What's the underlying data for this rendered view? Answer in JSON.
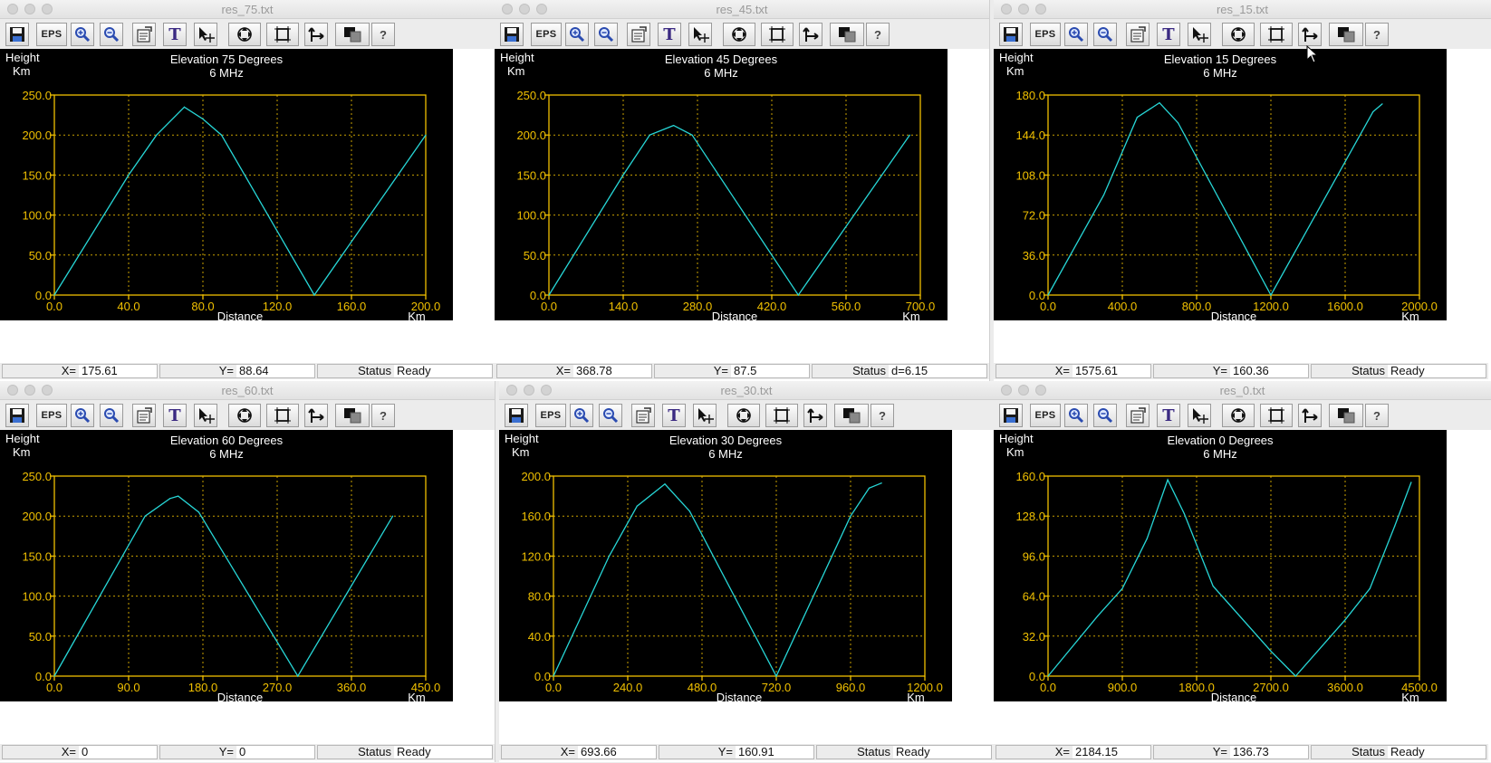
{
  "colors": {
    "plot_bg": "#000000",
    "axis": "#f0c000",
    "grid": "#c8a000",
    "tick_text": "#f0c000",
    "text": "#ffffff",
    "series": "#27d6d6"
  },
  "toolbar_icons": [
    "save-icon",
    "eps-button",
    "zoom-in-icon",
    "zoom-out-icon",
    "properties-icon",
    "text-icon",
    "move-cursor-icon",
    "fit-view-icon",
    "frame-icon",
    "axes-icon",
    "color-invert-icon",
    "help-icon"
  ],
  "toolbar_labels": {
    "eps": "EPS",
    "text": "T",
    "help": "?"
  },
  "windows": [
    {
      "title": "res_75.txt",
      "status": {
        "x_label": "X=",
        "x_value": "175.61",
        "y_label": "Y=",
        "y_value": "88.64",
        "status_label": "Status",
        "status_value": "Ready"
      },
      "chart_data": {
        "type": "line",
        "title": "Elevation 75 Degrees",
        "subtitle": "6 MHz",
        "ylabel": "Height",
        "yunit": "Km",
        "xlabel": "Distance",
        "xunit": "Km",
        "xlim": [
          0,
          200
        ],
        "ylim": [
          0,
          250
        ],
        "xticks": [
          "0.0",
          "40.0",
          "80.0",
          "120.0",
          "160.0",
          "200.0"
        ],
        "yticks": [
          "0.0",
          "50.0",
          "100.0",
          "150.0",
          "200.0",
          "250.0"
        ],
        "grid": true,
        "series": [
          {
            "x": [
              0,
              40,
              55,
              70,
              80,
              90,
              140,
              200
            ],
            "y": [
              0,
              150,
              200,
              235,
              220,
              200,
              0,
              200
            ]
          }
        ]
      }
    },
    {
      "title": "res_45.txt",
      "status": {
        "x_label": "X=",
        "x_value": "368.78",
        "y_label": "Y=",
        "y_value": "87.5",
        "status_label": "Status",
        "status_value": "d=6.15"
      },
      "chart_data": {
        "type": "line",
        "title": "Elevation 45 Degrees",
        "subtitle": "6 MHz",
        "ylabel": "Height",
        "yunit": "Km",
        "xlabel": "Distance",
        "xunit": "Km",
        "xlim": [
          0,
          700
        ],
        "ylim": [
          0,
          250
        ],
        "xticks": [
          "0.0",
          "140.0",
          "280.0",
          "420.0",
          "560.0",
          "700.0"
        ],
        "yticks": [
          "0.0",
          "50.0",
          "100.0",
          "150.0",
          "200.0",
          "250.0"
        ],
        "grid": true,
        "series": [
          {
            "x": [
              0,
              140,
              190,
              235,
              270,
              470,
              680
            ],
            "y": [
              0,
              150,
              200,
              212,
              200,
              0,
              200
            ]
          }
        ]
      }
    },
    {
      "title": "res_15.txt",
      "status": {
        "x_label": "X=",
        "x_value": "1575.61",
        "y_label": "Y=",
        "y_value": "160.36",
        "status_label": "Status",
        "status_value": "Ready"
      },
      "chart_data": {
        "type": "line",
        "title": "Elevation 15 Degrees",
        "subtitle": "6 MHz",
        "ylabel": "Height",
        "yunit": "Km",
        "xlabel": "Distance",
        "xunit": "Km",
        "xlim": [
          0,
          2000
        ],
        "ylim": [
          0,
          180
        ],
        "xticks": [
          "0.0",
          "400.0",
          "800.0",
          "1200.0",
          "1600.0",
          "2000.0"
        ],
        "yticks": [
          "0.0",
          "36.0",
          "72.0",
          "108.0",
          "144.0",
          "180.0"
        ],
        "grid": true,
        "series": [
          {
            "x": [
              0,
              300,
              480,
              600,
              700,
              1200,
              1600,
              1750,
              1800
            ],
            "y": [
              0,
              90,
              160,
              173,
              155,
              0,
              120,
              165,
              172
            ]
          }
        ]
      }
    },
    {
      "title": "res_60.txt",
      "status": {
        "x_label": "X=",
        "x_value": "0",
        "y_label": "Y=",
        "y_value": "0",
        "status_label": "Status",
        "status_value": "Ready"
      },
      "chart_data": {
        "type": "line",
        "title": "Elevation 60 Degrees",
        "subtitle": "6 MHz",
        "ylabel": "Height",
        "yunit": "Km",
        "xlabel": "Distance",
        "xunit": "Km",
        "xlim": [
          0,
          450
        ],
        "ylim": [
          0,
          250
        ],
        "xticks": [
          "0.0",
          "90.0",
          "180.0",
          "270.0",
          "360.0",
          "450.0"
        ],
        "yticks": [
          "0.0",
          "50.0",
          "100.0",
          "150.0",
          "200.0",
          "250.0"
        ],
        "grid": true,
        "series": [
          {
            "x": [
              0,
              110,
              140,
              150,
              175,
              295,
              410
            ],
            "y": [
              0,
              200,
              222,
              225,
              205,
              0,
              200
            ]
          }
        ]
      }
    },
    {
      "title": "res_30.txt",
      "status": {
        "x_label": "X=",
        "x_value": "693.66",
        "y_label": "Y=",
        "y_value": "160.91",
        "status_label": "Status",
        "status_value": "Ready"
      },
      "chart_data": {
        "type": "line",
        "title": "Elevation 30 Degrees",
        "subtitle": "6 MHz",
        "ylabel": "Height",
        "yunit": "Km",
        "xlabel": "Distance",
        "xunit": "Km",
        "xlim": [
          0,
          1200
        ],
        "ylim": [
          0,
          200
        ],
        "xticks": [
          "0.0",
          "240.0",
          "480.0",
          "720.0",
          "960.0",
          "1200.0"
        ],
        "yticks": [
          "0.0",
          "40.0",
          "80.0",
          "120.0",
          "160.0",
          "200.0"
        ],
        "grid": true,
        "series": [
          {
            "x": [
              0,
              180,
              270,
              360,
              440,
              720,
              960,
              1020,
              1060
            ],
            "y": [
              0,
              120,
              170,
              192,
              165,
              0,
              160,
              188,
              193
            ]
          }
        ]
      }
    },
    {
      "title": "res_0.txt",
      "status": {
        "x_label": "X=",
        "x_value": "2184.15",
        "y_label": "Y=",
        "y_value": "136.73",
        "status_label": "Status",
        "status_value": "Ready"
      },
      "chart_data": {
        "type": "line",
        "title": "Elevation 0 Degrees",
        "subtitle": "6 MHz",
        "ylabel": "Height",
        "yunit": "Km",
        "xlabel": "Distance",
        "xunit": "Km",
        "xlim": [
          0,
          4500
        ],
        "ylim": [
          0,
          160
        ],
        "xticks": [
          "0.0",
          "900.0",
          "1800.0",
          "2700.0",
          "3600.0",
          "4500.0"
        ],
        "yticks": [
          "0.0",
          "32.0",
          "64.0",
          "96.0",
          "128.0",
          "160.0"
        ],
        "grid": true,
        "series": [
          {
            "x": [
              0,
              600,
              900,
              1200,
              1450,
              1650,
              2000,
              2700,
              3000,
              3600,
              3900,
              4200,
              4400
            ],
            "y": [
              0,
              48,
              70,
              110,
              157,
              130,
              72,
              20,
              0,
              45,
              70,
              120,
              155
            ]
          }
        ]
      }
    }
  ]
}
